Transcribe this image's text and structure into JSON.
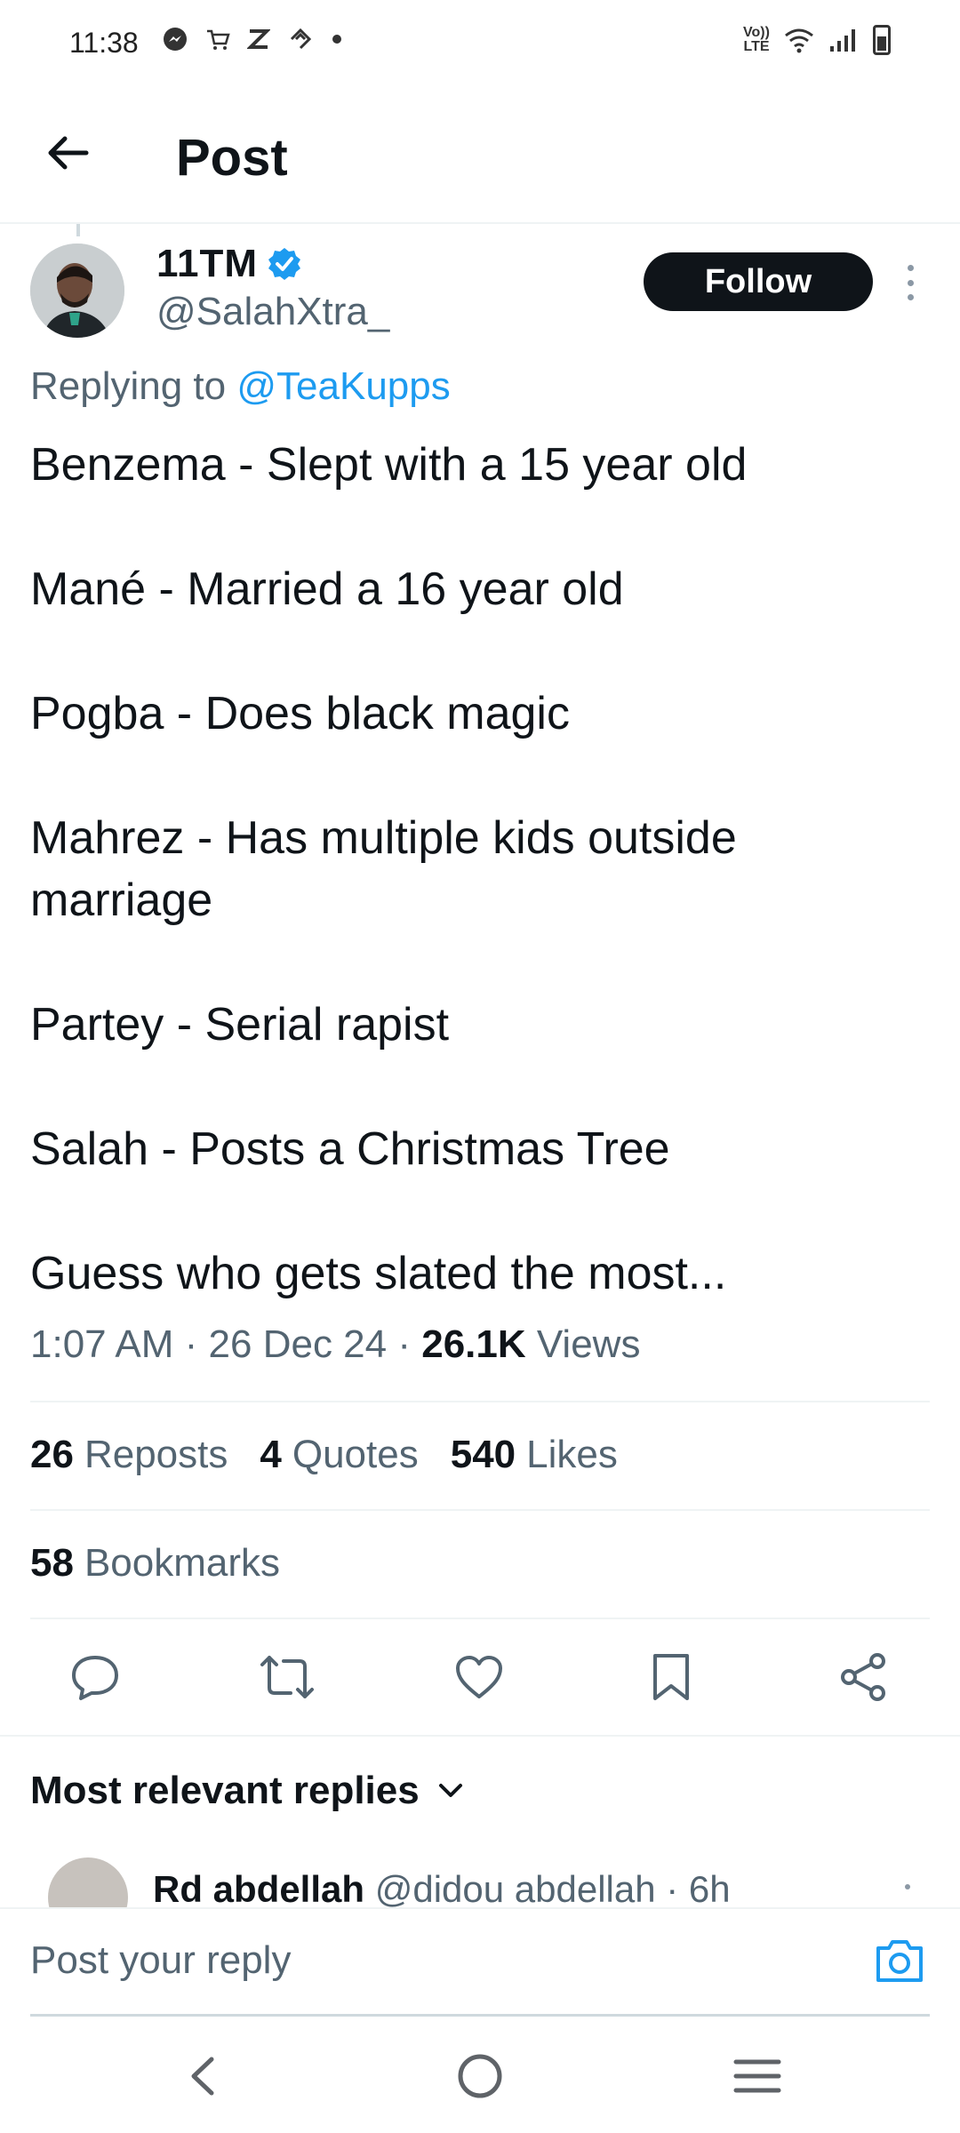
{
  "status_bar": {
    "time": "11:38",
    "left_icons": [
      "messenger-icon",
      "cart-icon",
      "z-icon",
      "reddit-icon",
      "dot-icon"
    ],
    "right_icons": [
      "volte-icon",
      "wifi-icon",
      "signal-icon",
      "battery-icon"
    ],
    "volte_label": "Vo)) LTE"
  },
  "header": {
    "title": "Post"
  },
  "post": {
    "author_name": "11TM",
    "author_handle": "@SalahXtra_",
    "verified": true,
    "follow_label": "Follow",
    "replying_prefix": "Replying to",
    "replying_to": "@TeaKupps",
    "lines": [
      "Benzema - Slept with a 15 year old",
      "Mané - Married a 16 year old",
      "Pogba - Does black magic",
      "Mahrez - Has multiple kids outside marriage",
      "Partey - Serial rapist",
      "Salah - Posts a Christmas Tree",
      "Guess who gets slated the most..."
    ],
    "timestamp": "1:07 AM · 26 Dec 24 · ",
    "views_count": "26.1K",
    "views_label": "Views"
  },
  "stats": {
    "reposts_count": "26",
    "reposts_label": "Reposts",
    "quotes_count": "4",
    "quotes_label": "Quotes",
    "likes_count": "540",
    "likes_label": "Likes",
    "bookmarks_count": "58",
    "bookmarks_label": "Bookmarks"
  },
  "actions": [
    "reply-icon",
    "repost-icon",
    "like-icon",
    "bookmark-icon",
    "share-icon"
  ],
  "replies_section": {
    "sort_label": "Most relevant replies"
  },
  "reply_preview": {
    "author_name": "Rd abdellah",
    "author_handle": "@didou abdellah · 6h"
  },
  "reply_bar": {
    "placeholder": "Post your reply"
  },
  "colors": {
    "accent": "#1d9bf0",
    "text_primary": "#0f1419",
    "text_secondary": "#536471",
    "follow_bg": "#0f1419"
  }
}
